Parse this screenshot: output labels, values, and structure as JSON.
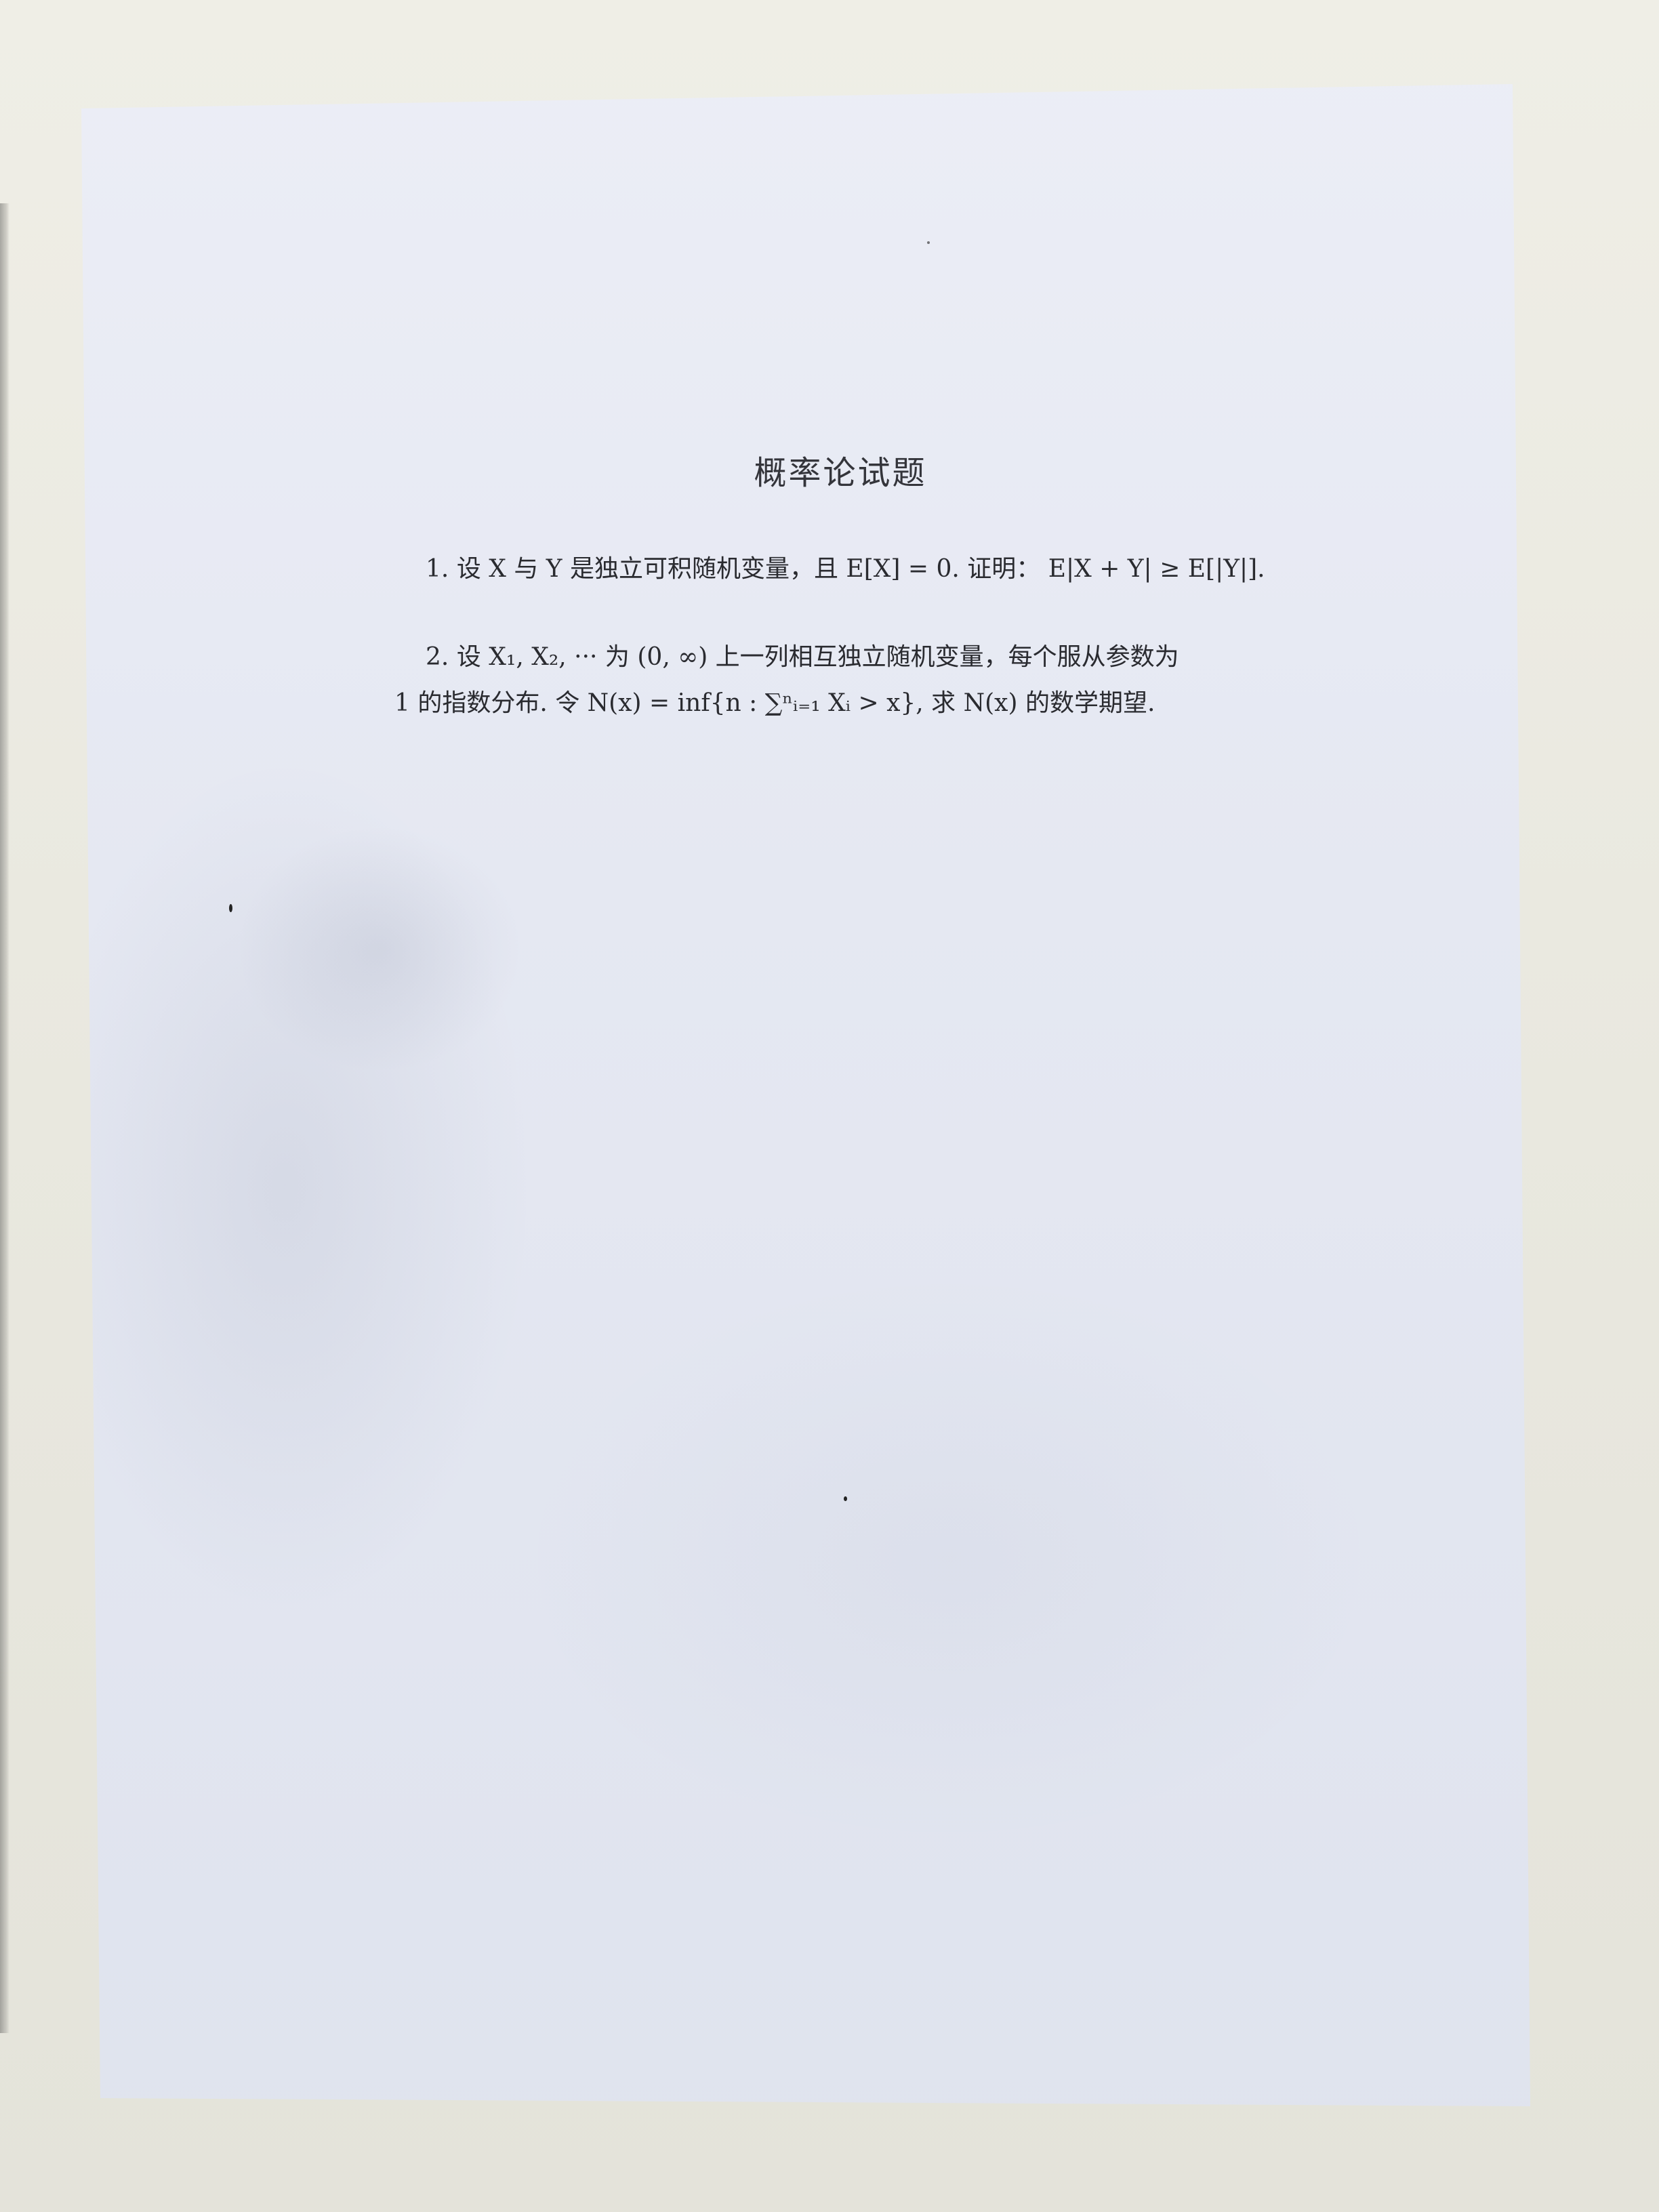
{
  "document": {
    "title": "概率论试题",
    "problems": [
      {
        "number": "1.",
        "lines": [
          "设 X 与 Y 是独立可积随机变量，且 E[X] = 0. 证明： E|X + Y| ≥ E[|Y|]."
        ]
      },
      {
        "number": "2.",
        "lines": [
          "设 X₁, X₂, ··· 为 (0, ∞) 上一列相互独立随机变量，每个服从参数为",
          "1 的指数分布. 令 N(x) = inf{n : ∑ⁿᵢ₌₁ Xᵢ > x}, 求 N(x) 的数学期望."
        ]
      }
    ]
  }
}
